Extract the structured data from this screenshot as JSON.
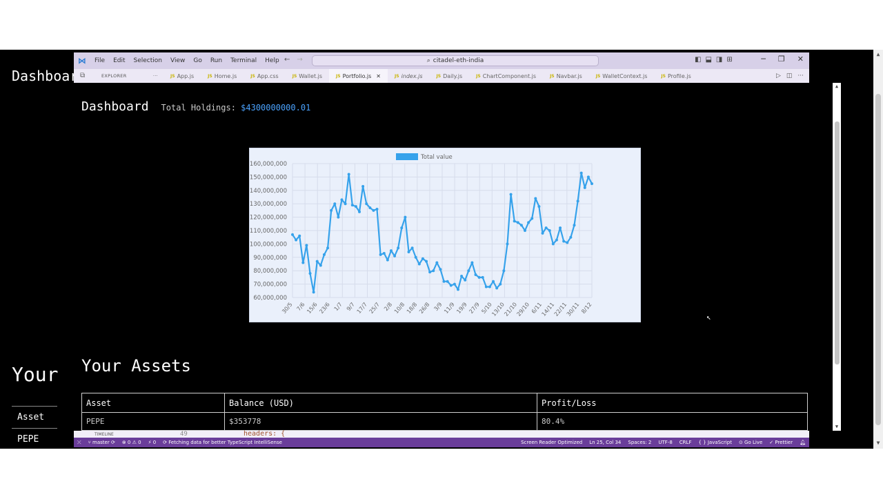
{
  "background_page": {
    "dashboard_heading": "Dashboard",
    "your_heading": "Your",
    "table_header": "Asset",
    "table_row_1": "PEPE"
  },
  "vscode": {
    "menu": [
      "File",
      "Edit",
      "Selection",
      "View",
      "Go",
      "Run",
      "Terminal",
      "Help"
    ],
    "search_text": "citadel-eth-india",
    "explorer_label": "EXPLORER",
    "tabs": [
      {
        "label": "App.js",
        "active": false
      },
      {
        "label": "Home.js",
        "active": false
      },
      {
        "label": "App.css",
        "active": false
      },
      {
        "label": "Wallet.js",
        "active": false
      },
      {
        "label": "Portfolio.js",
        "active": true
      },
      {
        "label": "index.js",
        "active": false
      },
      {
        "label": "Daily.js",
        "active": false
      },
      {
        "label": "ChartComponent.js",
        "active": false
      },
      {
        "label": "Navbar.js",
        "active": false
      },
      {
        "label": "WalletContext.js",
        "active": false
      },
      {
        "label": "Profile.js",
        "active": false
      }
    ],
    "timeline_label": "TIMELINE",
    "line_number": "49",
    "code_snippet": "headers: {",
    "status": {
      "branch": "master",
      "problems": "⊗ 0 ⚠ 0",
      "ports": "⚡ 0",
      "message": "Fetching data for better TypeScript IntelliSense",
      "screen_reader": "Screen Reader Optimized",
      "position": "Ln 25, Col 34",
      "spaces": "Spaces: 2",
      "encoding": "UTF-8",
      "eol": "CRLF",
      "language": "JavaScript",
      "go_live": "Go Live",
      "prettier": "✓ Prettier"
    }
  },
  "app": {
    "title": "Dashboard",
    "holdings_label": "Total Holdings:",
    "holdings_value": "$4300000000.01",
    "assets_title": "Your Assets",
    "columns": [
      "Asset",
      "Balance (USD)",
      "Profit/Loss"
    ],
    "rows": [
      [
        "PEPE",
        "$353778",
        "80.4%"
      ]
    ]
  },
  "colors": {
    "accent": "#4ba3ff",
    "chart_line": "#36a2eb",
    "statusbar": "#6a3d9a"
  },
  "chart_data": {
    "type": "line",
    "title": "",
    "series": [
      {
        "name": "Total value",
        "values": [
          107000000,
          103000000,
          106000000,
          86000000,
          99000000,
          78000000,
          64000000,
          87000000,
          84000000,
          92000000,
          97000000,
          125000000,
          130000000,
          120000000,
          133000000,
          130000000,
          152000000,
          129000000,
          128000000,
          124000000,
          143000000,
          130000000,
          127000000,
          125000000,
          126000000,
          92000000,
          93000000,
          88000000,
          95000000,
          91000000,
          97000000,
          112000000,
          120000000,
          94000000,
          97000000,
          90000000,
          85000000,
          89000000,
          87000000,
          79000000,
          80000000,
          86000000,
          81000000,
          72000000,
          72000000,
          69000000,
          70000000,
          66000000,
          76000000,
          73000000,
          80000000,
          86000000,
          77000000,
          75000000,
          75000000,
          68000000,
          68000000,
          72000000,
          67000000,
          70000000,
          80000000,
          100000000,
          137000000,
          117000000,
          116000000,
          114000000,
          110000000,
          116000000,
          119000000,
          134000000,
          128000000,
          108000000,
          112000000,
          110000000,
          100000000,
          103000000,
          112000000,
          102000000,
          101000000,
          105000000,
          114000000,
          132000000,
          153000000,
          142000000,
          150000000,
          145000000
        ]
      }
    ],
    "x_tick_labels": [
      "30/5",
      "7/6",
      "15/6",
      "23/6",
      "1/7",
      "9/7",
      "17/7",
      "25/7",
      "2/8",
      "10/8",
      "18/8",
      "26/8",
      "3/9",
      "11/9",
      "19/9",
      "27/9",
      "5/10",
      "13/10",
      "21/10",
      "29/10",
      "6/11",
      "14/11",
      "22/11",
      "30/11",
      "8/12"
    ],
    "y_tick_labels": [
      "160,000,000",
      "150,000,000",
      "140,000,000",
      "130,000,000",
      "120,000,000",
      "110,000,000",
      "100,000,000",
      "90,000,000",
      "80,000,000",
      "70,000,000",
      "60,000,000"
    ],
    "ylim": [
      60000000,
      160000000
    ],
    "grid": true,
    "legend": "top-center"
  }
}
